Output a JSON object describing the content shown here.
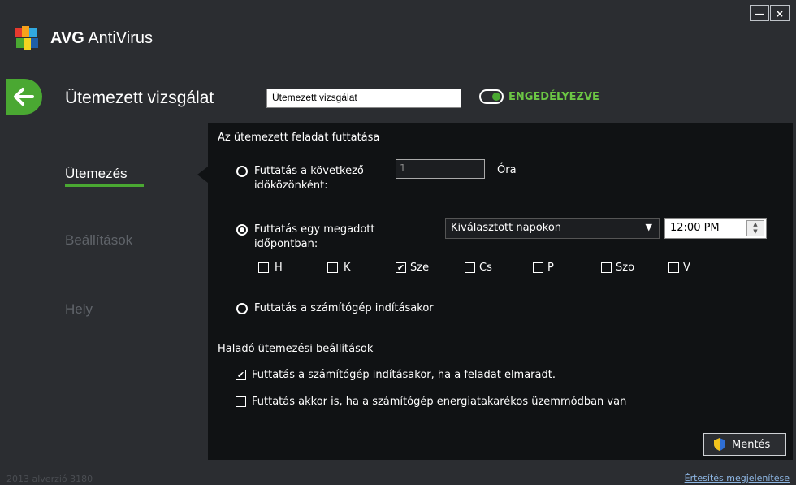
{
  "window": {
    "minimize": "—",
    "close": "×"
  },
  "app": {
    "brand": "AVG",
    "product": "AntiVirus",
    "logo": "avg-logo-icon"
  },
  "header": {
    "title": "Ütemezett vizsgálat",
    "name_value": "Ütemezett vizsgálat",
    "status": "ENGEDÉLYEZVE"
  },
  "nav": {
    "items": [
      {
        "label": "Ütemezés"
      },
      {
        "label": "Beállítások"
      },
      {
        "label": "Hely"
      }
    ]
  },
  "schedule": {
    "section_title": "Az ütemezett feladat futtatása",
    "interval": {
      "line1": "Futtatás a következő",
      "line2": "időközönként:",
      "value": "1",
      "unit": "Óra"
    },
    "specific": {
      "line1": "Futtatás egy megadott",
      "line2": "időpontban:",
      "dropdown": "Kiválasztott napokon",
      "time": "12:00 PM"
    },
    "days": [
      {
        "label": "H",
        "checked": false
      },
      {
        "label": "K",
        "checked": false
      },
      {
        "label": "Sze",
        "checked": true
      },
      {
        "label": "Cs",
        "checked": false
      },
      {
        "label": "P",
        "checked": false
      },
      {
        "label": "Szo",
        "checked": false
      },
      {
        "label": "V",
        "checked": false
      }
    ],
    "startup": "Futtatás a számítógép indításakor"
  },
  "advanced": {
    "title": "Haladó ütemezési beállítások",
    "missed": "Futtatás a számítógép indításakor, ha a feladat elmaradt.",
    "power": "Futtatás akkor is, ha a számítógép energiatakarékos üzemmódban van"
  },
  "save": "Mentés",
  "footer": {
    "version": "2013 alverzió 3180",
    "notify": "Értesítés megjelenítése"
  },
  "colors": {
    "accent": "#4aa832",
    "panel": "#101214",
    "background": "#2b2d31"
  }
}
